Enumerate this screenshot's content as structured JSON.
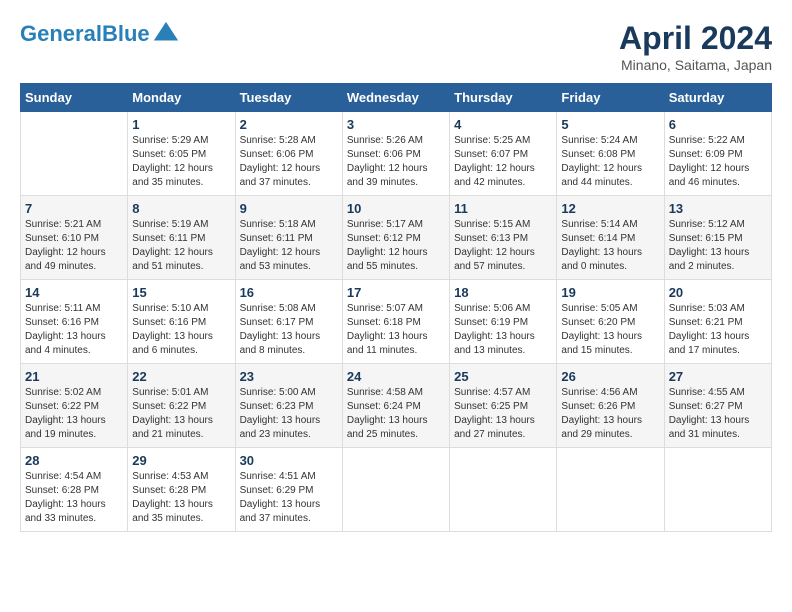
{
  "header": {
    "logo_line1": "General",
    "logo_line2": "Blue",
    "title": "April 2024",
    "subtitle": "Minano, Saitama, Japan"
  },
  "weekdays": [
    "Sunday",
    "Monday",
    "Tuesday",
    "Wednesday",
    "Thursday",
    "Friday",
    "Saturday"
  ],
  "weeks": [
    [
      {
        "day": "",
        "info": ""
      },
      {
        "day": "1",
        "info": "Sunrise: 5:29 AM\nSunset: 6:05 PM\nDaylight: 12 hours\nand 35 minutes."
      },
      {
        "day": "2",
        "info": "Sunrise: 5:28 AM\nSunset: 6:06 PM\nDaylight: 12 hours\nand 37 minutes."
      },
      {
        "day": "3",
        "info": "Sunrise: 5:26 AM\nSunset: 6:06 PM\nDaylight: 12 hours\nand 39 minutes."
      },
      {
        "day": "4",
        "info": "Sunrise: 5:25 AM\nSunset: 6:07 PM\nDaylight: 12 hours\nand 42 minutes."
      },
      {
        "day": "5",
        "info": "Sunrise: 5:24 AM\nSunset: 6:08 PM\nDaylight: 12 hours\nand 44 minutes."
      },
      {
        "day": "6",
        "info": "Sunrise: 5:22 AM\nSunset: 6:09 PM\nDaylight: 12 hours\nand 46 minutes."
      }
    ],
    [
      {
        "day": "7",
        "info": "Sunrise: 5:21 AM\nSunset: 6:10 PM\nDaylight: 12 hours\nand 49 minutes."
      },
      {
        "day": "8",
        "info": "Sunrise: 5:19 AM\nSunset: 6:11 PM\nDaylight: 12 hours\nand 51 minutes."
      },
      {
        "day": "9",
        "info": "Sunrise: 5:18 AM\nSunset: 6:11 PM\nDaylight: 12 hours\nand 53 minutes."
      },
      {
        "day": "10",
        "info": "Sunrise: 5:17 AM\nSunset: 6:12 PM\nDaylight: 12 hours\nand 55 minutes."
      },
      {
        "day": "11",
        "info": "Sunrise: 5:15 AM\nSunset: 6:13 PM\nDaylight: 12 hours\nand 57 minutes."
      },
      {
        "day": "12",
        "info": "Sunrise: 5:14 AM\nSunset: 6:14 PM\nDaylight: 13 hours\nand 0 minutes."
      },
      {
        "day": "13",
        "info": "Sunrise: 5:12 AM\nSunset: 6:15 PM\nDaylight: 13 hours\nand 2 minutes."
      }
    ],
    [
      {
        "day": "14",
        "info": "Sunrise: 5:11 AM\nSunset: 6:16 PM\nDaylight: 13 hours\nand 4 minutes."
      },
      {
        "day": "15",
        "info": "Sunrise: 5:10 AM\nSunset: 6:16 PM\nDaylight: 13 hours\nand 6 minutes."
      },
      {
        "day": "16",
        "info": "Sunrise: 5:08 AM\nSunset: 6:17 PM\nDaylight: 13 hours\nand 8 minutes."
      },
      {
        "day": "17",
        "info": "Sunrise: 5:07 AM\nSunset: 6:18 PM\nDaylight: 13 hours\nand 11 minutes."
      },
      {
        "day": "18",
        "info": "Sunrise: 5:06 AM\nSunset: 6:19 PM\nDaylight: 13 hours\nand 13 minutes."
      },
      {
        "day": "19",
        "info": "Sunrise: 5:05 AM\nSunset: 6:20 PM\nDaylight: 13 hours\nand 15 minutes."
      },
      {
        "day": "20",
        "info": "Sunrise: 5:03 AM\nSunset: 6:21 PM\nDaylight: 13 hours\nand 17 minutes."
      }
    ],
    [
      {
        "day": "21",
        "info": "Sunrise: 5:02 AM\nSunset: 6:22 PM\nDaylight: 13 hours\nand 19 minutes."
      },
      {
        "day": "22",
        "info": "Sunrise: 5:01 AM\nSunset: 6:22 PM\nDaylight: 13 hours\nand 21 minutes."
      },
      {
        "day": "23",
        "info": "Sunrise: 5:00 AM\nSunset: 6:23 PM\nDaylight: 13 hours\nand 23 minutes."
      },
      {
        "day": "24",
        "info": "Sunrise: 4:58 AM\nSunset: 6:24 PM\nDaylight: 13 hours\nand 25 minutes."
      },
      {
        "day": "25",
        "info": "Sunrise: 4:57 AM\nSunset: 6:25 PM\nDaylight: 13 hours\nand 27 minutes."
      },
      {
        "day": "26",
        "info": "Sunrise: 4:56 AM\nSunset: 6:26 PM\nDaylight: 13 hours\nand 29 minutes."
      },
      {
        "day": "27",
        "info": "Sunrise: 4:55 AM\nSunset: 6:27 PM\nDaylight: 13 hours\nand 31 minutes."
      }
    ],
    [
      {
        "day": "28",
        "info": "Sunrise: 4:54 AM\nSunset: 6:28 PM\nDaylight: 13 hours\nand 33 minutes."
      },
      {
        "day": "29",
        "info": "Sunrise: 4:53 AM\nSunset: 6:28 PM\nDaylight: 13 hours\nand 35 minutes."
      },
      {
        "day": "30",
        "info": "Sunrise: 4:51 AM\nSunset: 6:29 PM\nDaylight: 13 hours\nand 37 minutes."
      },
      {
        "day": "",
        "info": ""
      },
      {
        "day": "",
        "info": ""
      },
      {
        "day": "",
        "info": ""
      },
      {
        "day": "",
        "info": ""
      }
    ]
  ]
}
